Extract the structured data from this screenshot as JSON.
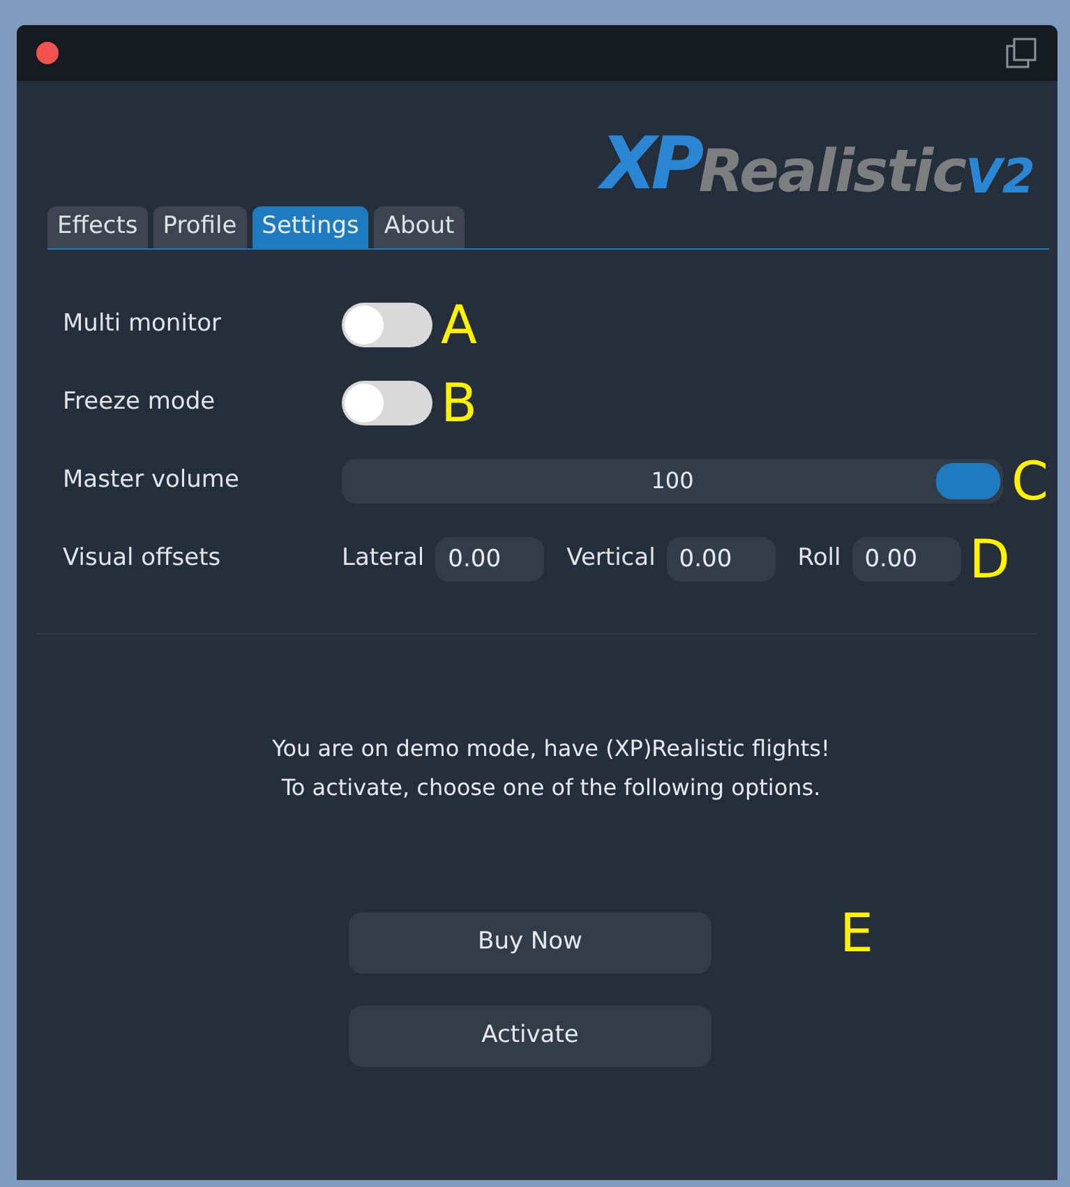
{
  "logo": {
    "part_1": "XP",
    "part_2": "Realistic",
    "part_3": "V2"
  },
  "tabs": [
    {
      "label": "Effects",
      "selected": false
    },
    {
      "label": "Profile",
      "selected": false
    },
    {
      "label": "Settings",
      "selected": true
    },
    {
      "label": "About",
      "selected": false
    }
  ],
  "settings": [
    {
      "kind": "toggle",
      "label": "Multi monitor",
      "on": false,
      "annotation": "A"
    },
    {
      "kind": "toggle",
      "label": "Freeze mode",
      "on": false,
      "annotation": "B"
    },
    {
      "kind": "slider",
      "label": "Master volume",
      "value": "100",
      "level": 1,
      "annotation": "C"
    },
    {
      "kind": "offsets",
      "label": "Visual offsets",
      "fields": [
        {
          "label": "Lateral",
          "value": "0.00"
        },
        {
          "label": "Vertical",
          "value": "0.00"
        },
        {
          "label": "Roll",
          "value": "0.00"
        }
      ],
      "annotation": "D"
    }
  ],
  "message": [
    "You are on demo mode, have (XP)Realistic flights!",
    "To activate, choose one of the following options."
  ],
  "buttons": [
    "Buy Now",
    "Activate"
  ],
  "buttons_annotation": "E"
}
